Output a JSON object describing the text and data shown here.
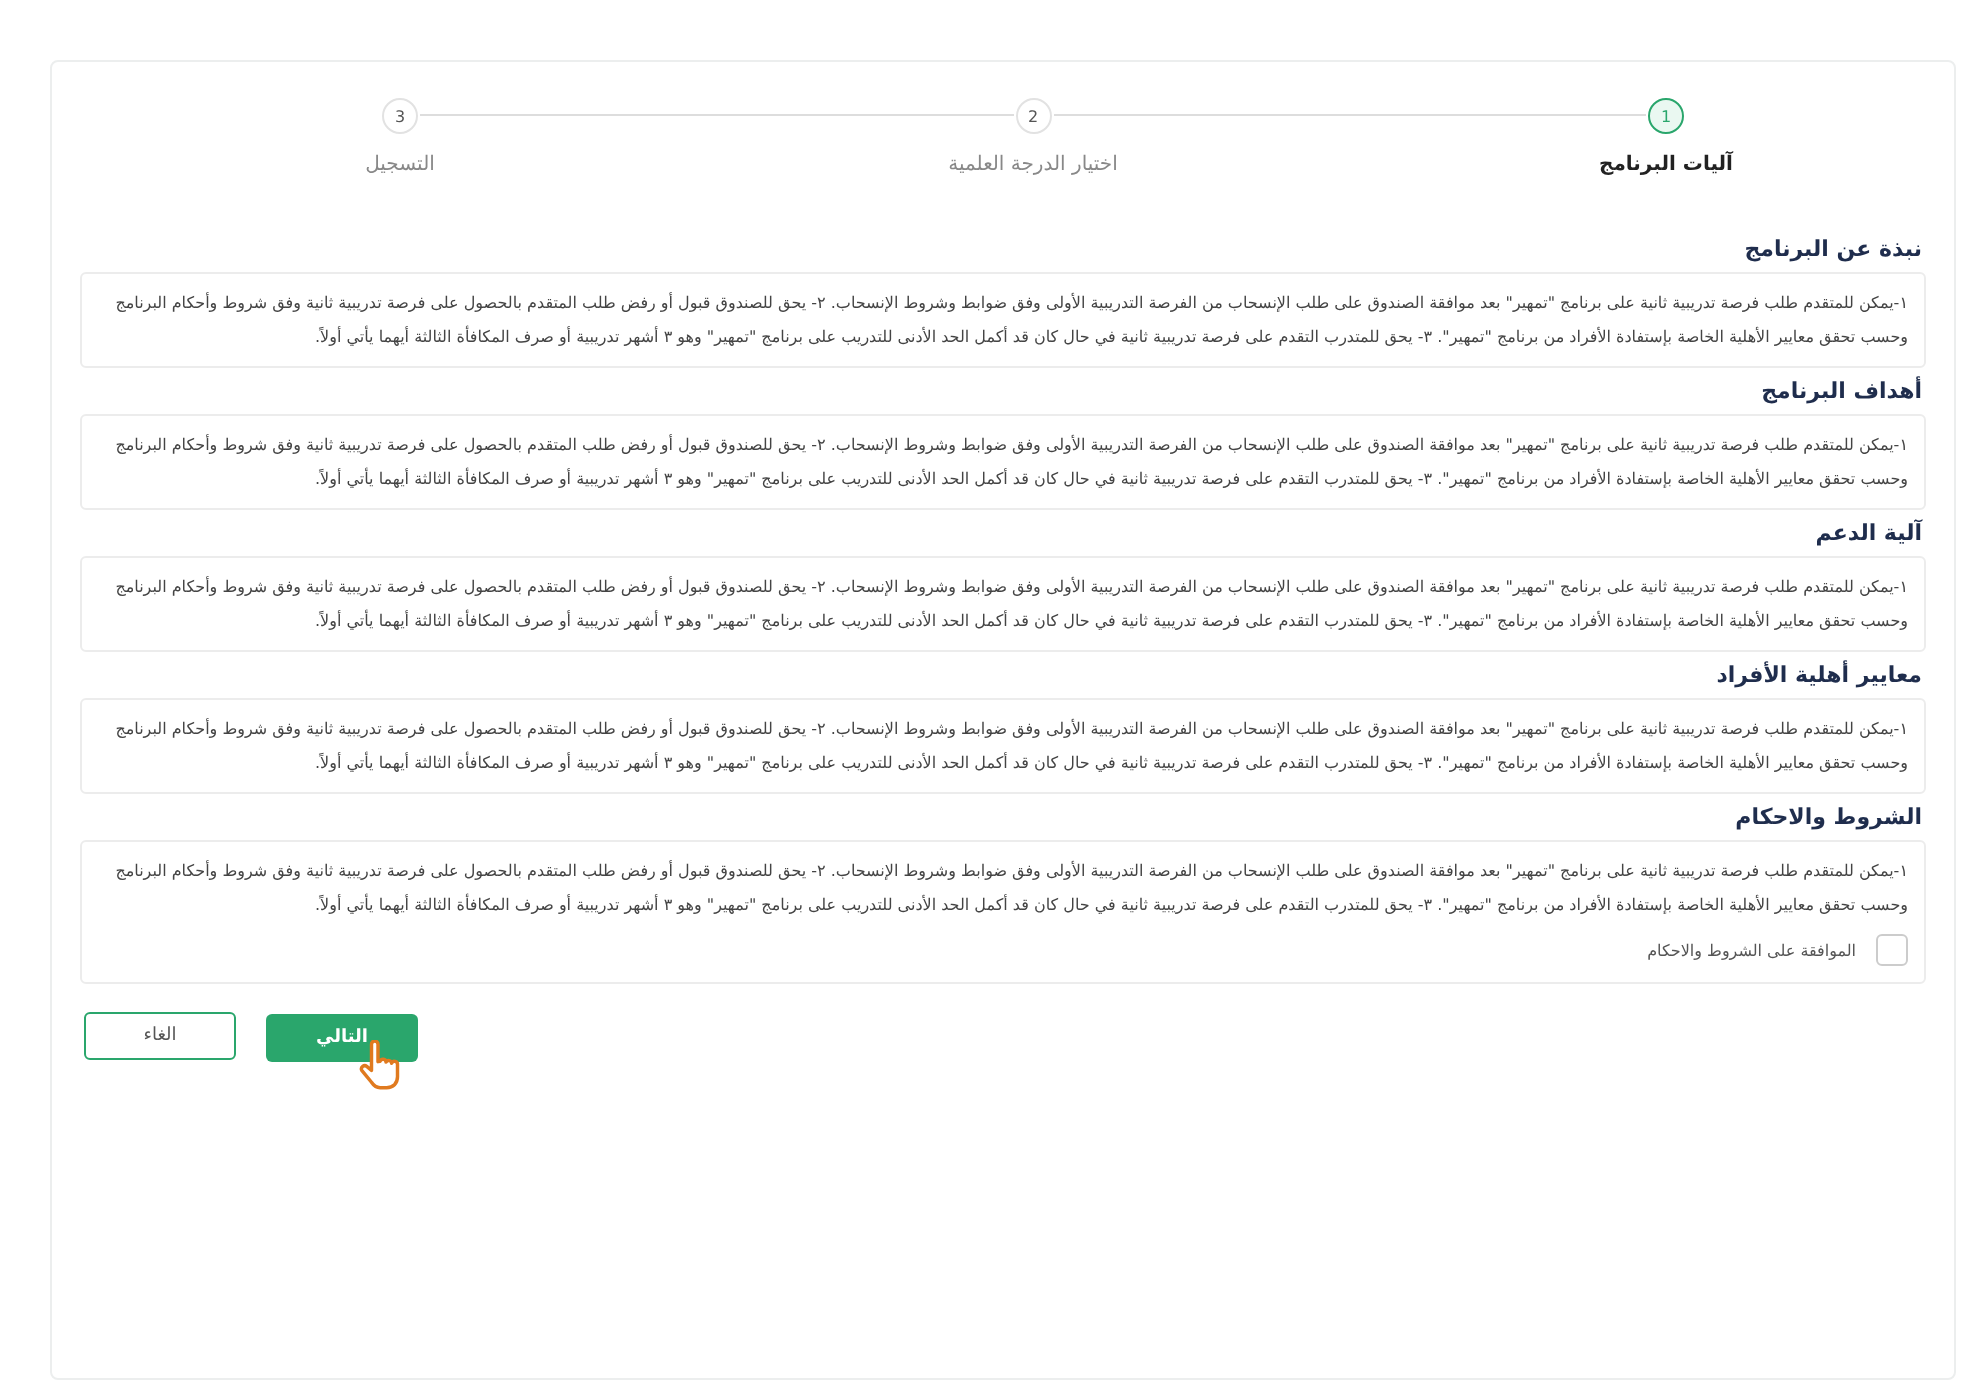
{
  "steps": [
    {
      "number": "1",
      "label": "آليات البرنامج",
      "selected": true
    },
    {
      "number": "2",
      "label": "اختيار الدرجة العلمية",
      "selected": false
    },
    {
      "number": "3",
      "label": "التسجيل",
      "selected": false
    }
  ],
  "sections": [
    {
      "title": "نبذة عن البرنامج",
      "text": "١-يمكن للمتقدم طلب فرصة تدريبية ثانية على برنامج \"تمهير\" بعد موافقة الصندوق على طلب الإنسحاب من الفرصة التدريبية الأولى وفق ضوابط وشروط الإنسحاب. ٢- يحق للصندوق قبول أو رفض طلب المتقدم بالحصول على فرصة تدريبية ثانية وفق شروط وأحكام البرنامج وحسب تحقق معايير الأهلية الخاصة بإستفادة الأفراد من برنامج \"تمهير\". ٣- يحق للمتدرب التقدم على فرصة تدريبية ثانية في حال كان قد أكمل الحد الأدنى للتدريب على برنامج \"تمهير\" وهو ٣ أشهر تدريبية أو صرف المكافأة الثالثة أيهما يأتي أولاً."
    },
    {
      "title": "أهداف البرنامج",
      "text": "١-يمكن للمتقدم طلب فرصة تدريبية ثانية على برنامج \"تمهير\" بعد موافقة الصندوق على طلب الإنسحاب من الفرصة التدريبية الأولى وفق ضوابط وشروط الإنسحاب. ٢- يحق للصندوق قبول أو رفض طلب المتقدم بالحصول على فرصة تدريبية ثانية وفق شروط وأحكام البرنامج وحسب تحقق معايير الأهلية الخاصة بإستفادة الأفراد من برنامج \"تمهير\". ٣- يحق للمتدرب التقدم على فرصة تدريبية ثانية في حال كان قد أكمل الحد الأدنى للتدريب على برنامج \"تمهير\" وهو ٣ أشهر تدريبية أو صرف المكافأة الثالثة أيهما يأتي أولاً."
    },
    {
      "title": "آلية الدعم",
      "text": "١-يمكن للمتقدم طلب فرصة تدريبية ثانية على برنامج \"تمهير\" بعد موافقة الصندوق على طلب الإنسحاب من الفرصة التدريبية الأولى وفق ضوابط وشروط الإنسحاب. ٢- يحق للصندوق قبول أو رفض طلب المتقدم بالحصول على فرصة تدريبية ثانية وفق شروط وأحكام البرنامج وحسب تحقق معايير الأهلية الخاصة بإستفادة الأفراد من برنامج \"تمهير\". ٣- يحق للمتدرب التقدم على فرصة تدريبية ثانية في حال كان قد أكمل الحد الأدنى للتدريب على برنامج \"تمهير\" وهو ٣ أشهر تدريبية أو صرف المكافأة الثالثة أيهما يأتي أولاً."
    },
    {
      "title": "معايير أهلية الأفراد",
      "text": "١-يمكن للمتقدم طلب فرصة تدريبية ثانية على برنامج \"تمهير\" بعد موافقة الصندوق على طلب الإنسحاب من الفرصة التدريبية الأولى وفق ضوابط وشروط الإنسحاب. ٢- يحق للصندوق قبول أو رفض طلب المتقدم بالحصول على فرصة تدريبية ثانية وفق شروط وأحكام البرنامج وحسب تحقق معايير الأهلية الخاصة بإستفادة الأفراد من برنامج \"تمهير\". ٣- يحق للمتدرب التقدم على فرصة تدريبية ثانية في حال كان قد أكمل الحد الأدنى للتدريب على برنامج \"تمهير\" وهو ٣ أشهر تدريبية أو صرف المكافأة الثالثة أيهما يأتي أولاً."
    },
    {
      "title": "الشروط والاحكام",
      "text": "١-يمكن للمتقدم طلب فرصة تدريبية ثانية على برنامج \"تمهير\" بعد موافقة الصندوق على طلب الإنسحاب من الفرصة التدريبية الأولى وفق ضوابط وشروط الإنسحاب. ٢- يحق للصندوق قبول أو رفض طلب المتقدم بالحصول على فرصة تدريبية ثانية وفق شروط وأحكام البرنامج وحسب تحقق معايير الأهلية الخاصة بإستفادة الأفراد من برنامج \"تمهير\". ٣- يحق للمتدرب التقدم على فرصة تدريبية ثانية في حال كان قد أكمل الحد الأدنى للتدريب على برنامج \"تمهير\" وهو ٣ أشهر تدريبية أو صرف المكافأة الثالثة أيهما يأتي أولاً.",
      "agreement": {
        "label": "الموافقة على الشروط والاحكام",
        "checked": false
      }
    }
  ],
  "buttons": {
    "next": "التالي",
    "cancel": "الغاء"
  }
}
